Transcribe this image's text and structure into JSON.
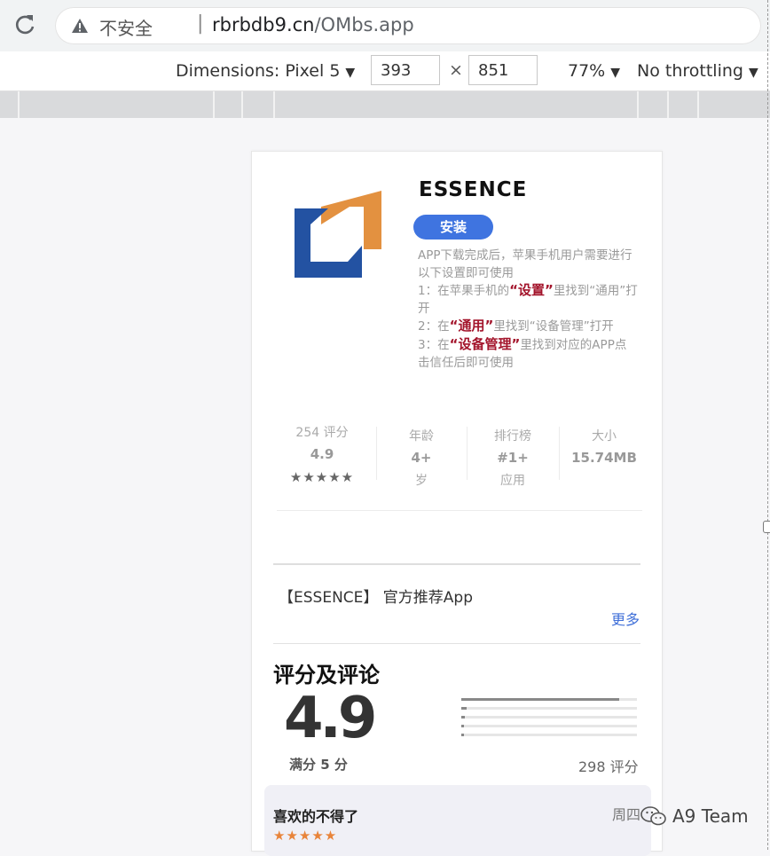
{
  "browser": {
    "security_label": "不安全",
    "separator": "|",
    "host": "rbrbdb9.cn",
    "path": "/OMbs.app"
  },
  "devtools": {
    "dimensions_label": "Dimensions: Pixel 5",
    "width": "393",
    "times": "×",
    "height": "851",
    "zoom": "77%",
    "throttling": "No throttling"
  },
  "app": {
    "name": "ESSENCE",
    "install_label": "安装",
    "logo_colors": {
      "orange": "#e39140",
      "blue": "#2352a2"
    },
    "instructions": {
      "line1": "APP下载完成后，苹果手机用户需要进行以下设置即可使用",
      "step1_pre": "1：在苹果手机的",
      "step1_hl": "“设置”",
      "step1_post": "里找到“通用”打开",
      "step2_pre": "2：在",
      "step2_hl": "“通用”",
      "step2_post": "里找到“设备管理”打开",
      "step3_pre": "3：在",
      "step3_hl": "“设备管理”",
      "step3_post": "里找到对应的APP点击信任后即可使用"
    }
  },
  "stats": {
    "ratings_label": "254 评分",
    "rating_value": "4.9",
    "stars": "★★★★★",
    "age_label": "年龄",
    "age_value": "4+",
    "age_unit": "岁",
    "rank_label": "排行榜",
    "rank_value": "#1+",
    "rank_unit": "应用",
    "size_label": "大小",
    "size_value": "15.74MB"
  },
  "official_text": "【ESSENCE】 官方推荐App",
  "more_label": "更多",
  "ratings": {
    "title": "评分及评论",
    "score": "4.9",
    "full_label": "满分 5 分",
    "count_label": "298 评分",
    "distribution": [
      0.9,
      0.03,
      0.02,
      0.01,
      0.01
    ]
  },
  "review": {
    "title": "喜欢的不得了",
    "day": "周四",
    "stars": "★★★★★"
  },
  "watermark": "A9 Team"
}
